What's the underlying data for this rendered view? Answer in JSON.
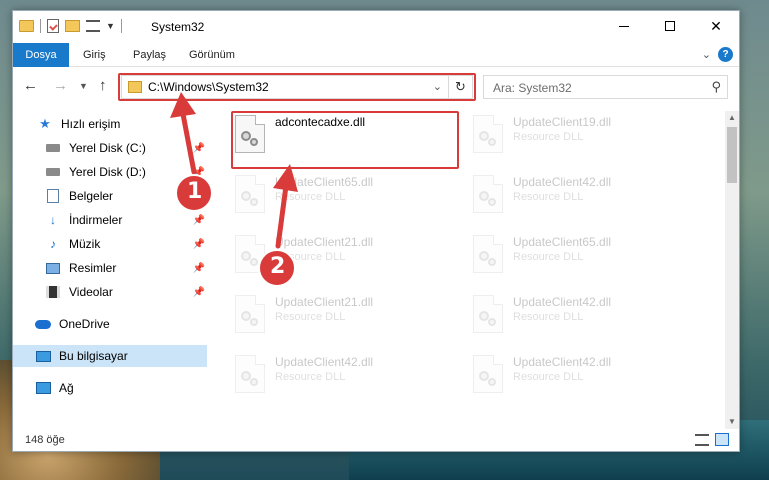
{
  "window": {
    "title": "System32"
  },
  "ribbon": {
    "tabs": [
      "Dosya",
      "Giriş",
      "Paylaş",
      "Görünüm"
    ]
  },
  "address": {
    "path": "C:\\Windows\\System32"
  },
  "search": {
    "placeholder": "Ara: System32"
  },
  "sidebar": {
    "items": [
      {
        "label": "Hızlı erişim",
        "icon": "star-icon",
        "pinned": false
      },
      {
        "label": "Yerel Disk (C:)",
        "icon": "drive-icon",
        "pinned": true
      },
      {
        "label": "Yerel Disk (D:)",
        "icon": "drive-icon",
        "pinned": true
      },
      {
        "label": "Belgeler",
        "icon": "documents-icon",
        "pinned": true
      },
      {
        "label": "İndirmeler",
        "icon": "download-icon",
        "pinned": true
      },
      {
        "label": "Müzik",
        "icon": "music-icon",
        "pinned": true
      },
      {
        "label": "Resimler",
        "icon": "pictures-icon",
        "pinned": true
      },
      {
        "label": "Videolar",
        "icon": "videos-icon",
        "pinned": true
      },
      {
        "label": "OneDrive",
        "icon": "cloud-icon",
        "pinned": false
      },
      {
        "label": "Bu bilgisayar",
        "icon": "computer-icon",
        "pinned": false,
        "selected": true
      },
      {
        "label": "Ağ",
        "icon": "network-icon",
        "pinned": false
      }
    ]
  },
  "files": [
    {
      "name": "adcontecadxe.dll",
      "type": "",
      "faded": false
    },
    {
      "name": "UpdateClient19.dll",
      "type": "Resource DLL",
      "faded": true
    },
    {
      "name": "UpdateClient65.dll",
      "type": "Resource DLL",
      "faded": true
    },
    {
      "name": "UpdateClient42.dll",
      "type": "Resource DLL",
      "faded": true
    },
    {
      "name": "UpdateClient21.dll",
      "type": "Resource DLL",
      "faded": true
    },
    {
      "name": "UpdateClient65.dll",
      "type": "Resource DLL",
      "faded": true
    },
    {
      "name": "UpdateClient21.dll",
      "type": "Resource DLL",
      "faded": true
    },
    {
      "name": "UpdateClient42.dll",
      "type": "Resource DLL",
      "faded": true
    },
    {
      "name": "UpdateClient42.dll",
      "type": "Resource DLL",
      "faded": true
    },
    {
      "name": "UpdateClient42.dll",
      "type": "Resource DLL",
      "faded": true
    }
  ],
  "status": {
    "count": "148 öğe"
  },
  "callouts": [
    {
      "number": "1"
    },
    {
      "number": "2"
    }
  ],
  "colors": {
    "accent": "#1979ca",
    "annotation_red": "#d93a3a",
    "selection": "#cce4f7"
  }
}
